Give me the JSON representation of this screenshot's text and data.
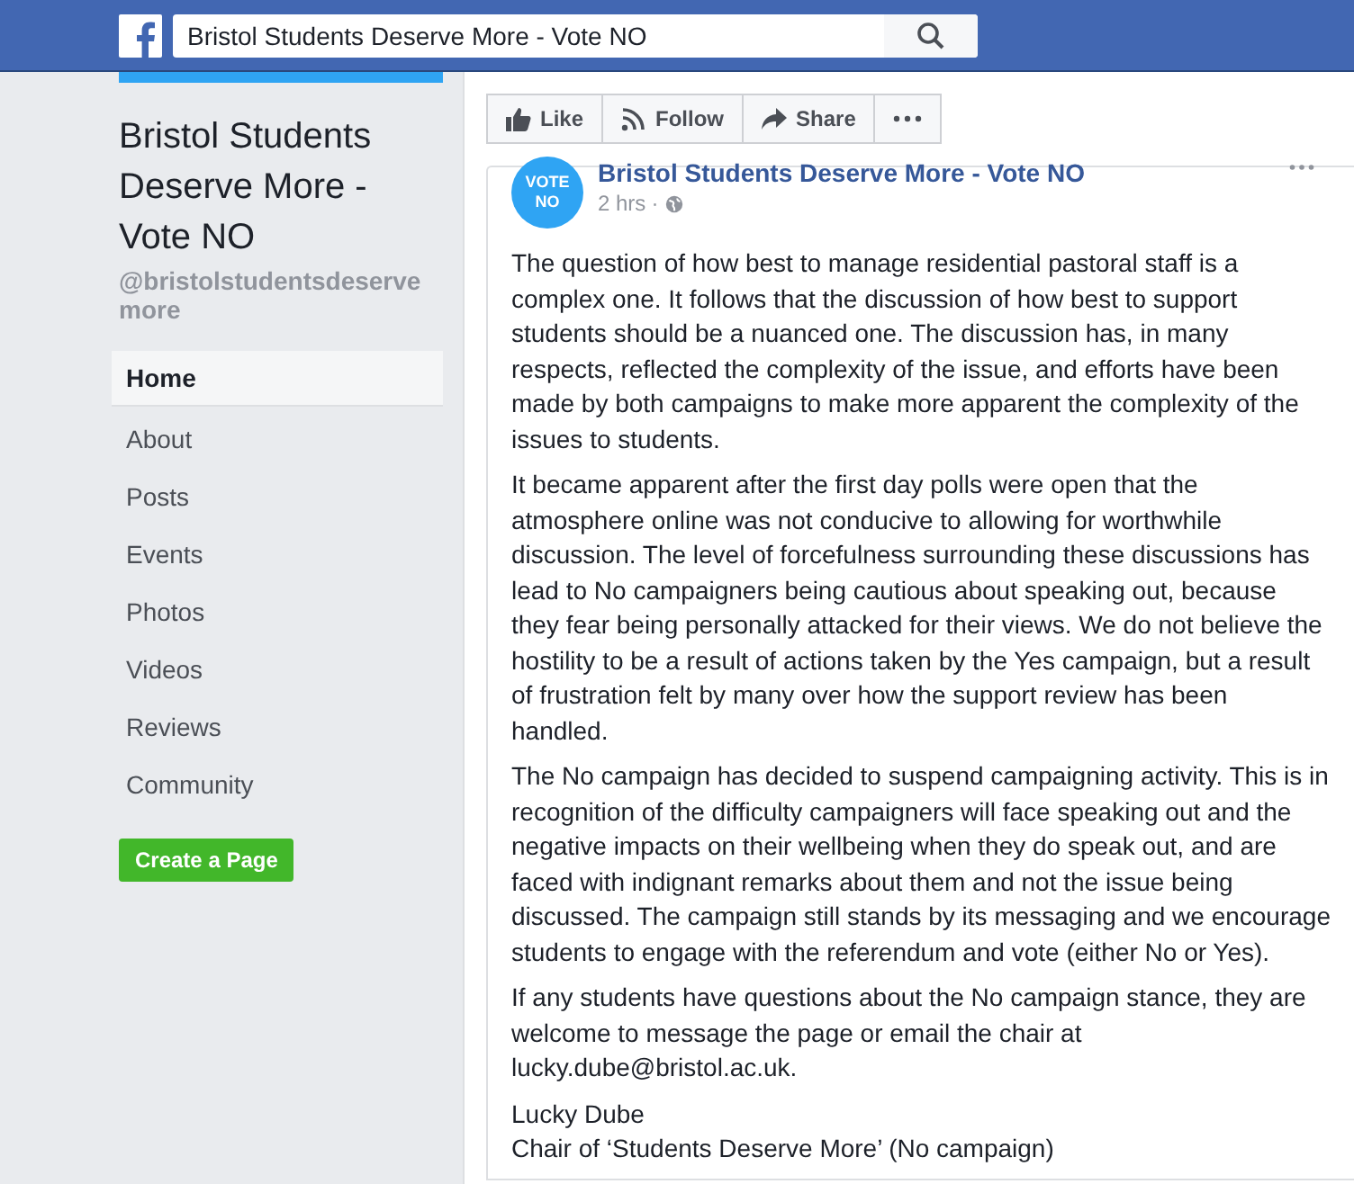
{
  "header": {
    "search": {
      "value": "Bristol Students Deserve More - Vote NO"
    }
  },
  "sidebar": {
    "page_title": "Bristol Students Deserve More - Vote NO",
    "handle": "@bristolstudentsdeserve more",
    "items": [
      {
        "label": "Home",
        "selected": true
      },
      {
        "label": "About",
        "selected": false
      },
      {
        "label": "Posts",
        "selected": false
      },
      {
        "label": "Events",
        "selected": false
      },
      {
        "label": "Photos",
        "selected": false
      },
      {
        "label": "Videos",
        "selected": false
      },
      {
        "label": "Reviews",
        "selected": false
      },
      {
        "label": "Community",
        "selected": false
      }
    ],
    "create_button": "Create a Page"
  },
  "actions": [
    {
      "kind": "like",
      "label": "Like"
    },
    {
      "kind": "follow",
      "label": "Follow"
    },
    {
      "kind": "share",
      "label": "Share"
    },
    {
      "kind": "more"
    }
  ],
  "post": {
    "avatar_text": [
      "VOTE",
      "NO"
    ],
    "author": "Bristol Students Deserve More - Vote NO",
    "time": "2 hrs",
    "separator": "·",
    "paragraphs": [
      [
        "The question of how best to manage residential pastoral staff is a complex one. It follows that the discussion of how best to support students should be a nuanced one. The discussion has, in many respects, reflected the complexity of the issue, and efforts have been made by both campaigns to make more apparent the complexity of the issues to students."
      ],
      [
        "It became apparent after the first day polls were open that the atmosphere online was not conducive to allowing for worthwhile discussion. The level of forcefulness surrounding these discussions has lead to No campaigners being cautious about speaking out, because they fear being personally attacked for their views. We do not believe the hostility to be a result of actions taken by the Yes campaign, but a result of frustration felt by many over how the support review has been handled."
      ],
      [
        "The No campaign has decided to suspend campaigning activity. This is in recognition of the difficulty campaigners will face speaking out and the negative impacts on their wellbeing when they do speak out, and are faced with indignant remarks about them and not the issue being discussed. The campaign still stands by its messaging and we encourage students to engage with the referendum and vote (either No or Yes)."
      ],
      [
        "If any students have questions about the No campaign stance, they are welcome to message the page or email the chair at lucky.dube@bristol.ac.uk."
      ],
      [
        "Lucky Dube",
        "Chair of ‘Students Deserve More’ (No campaign)"
      ]
    ]
  }
}
